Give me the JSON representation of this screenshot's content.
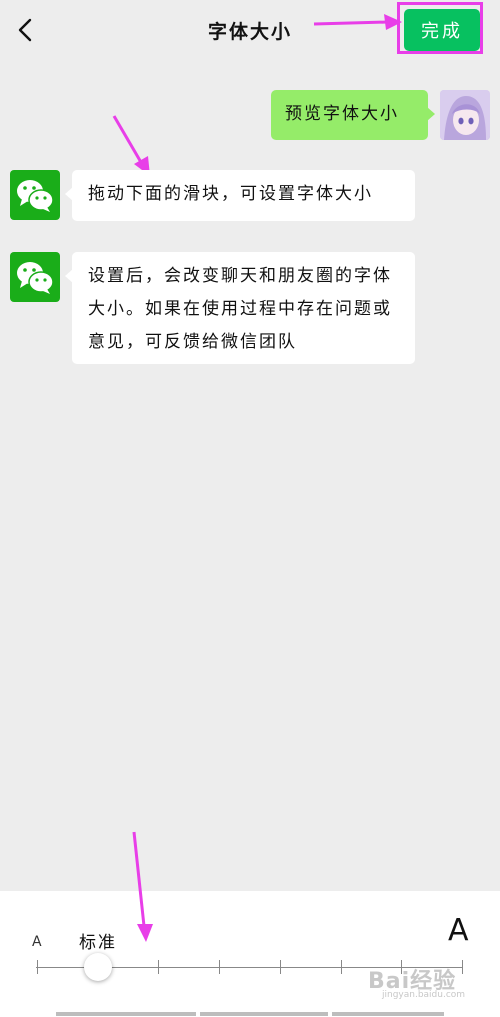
{
  "header": {
    "title": "字体大小",
    "done_label": "完成",
    "back_icon": "chevron-left-icon"
  },
  "chat": {
    "outgoing": {
      "text": "预览字体大小",
      "avatar": "anime-avatar"
    },
    "incoming": [
      {
        "text": "拖动下面的滑块，可设置字体大小",
        "avatar": "wechat-logo-icon"
      },
      {
        "text": "设置后，会改变聊天和朋友圈的字体大小。如果在使用过程中存在问题或意见，可反馈给微信团队",
        "avatar": "wechat-logo-icon"
      }
    ]
  },
  "font_slider": {
    "small_label": "A",
    "large_label": "A",
    "current_label": "标准",
    "level_count": 8,
    "selected_level": 2
  },
  "watermark": {
    "text": "Bai经验",
    "url": "jingyan.baidu.com"
  },
  "colors": {
    "accent": "#07c160",
    "bubble_out": "#95ec69",
    "annotation": "#e83ee8",
    "background": "#ededed"
  }
}
